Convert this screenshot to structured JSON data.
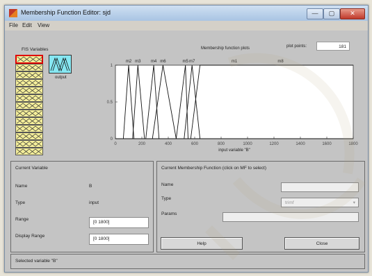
{
  "window": {
    "title": "Membership Function Editor: sjd",
    "minimize_glyph": "—",
    "maximize_glyph": "▢",
    "close_glyph": "✕"
  },
  "menu": [
    "File",
    "Edit",
    "View"
  ],
  "fis": {
    "title": "FIS Variables",
    "output_label": "output",
    "input_count": 13,
    "selected_index": 0
  },
  "plot": {
    "title": "Membership function plots",
    "plot_points_label": "plot points:",
    "plot_points_value": "181",
    "xlabel": "input variable \"B\"",
    "y_ticks": [
      "1",
      "0.5",
      "0"
    ],
    "x_ticks": [
      "0",
      "200",
      "400",
      "600",
      "800",
      "1000",
      "1200",
      "1400",
      "1600",
      "1800"
    ],
    "mf_labels": [
      "m2",
      "m3",
      "m4",
      "m6",
      "m5",
      "m7",
      "m1",
      "m8"
    ]
  },
  "chart_data": {
    "type": "line",
    "xlabel": "input variable \"B\"",
    "xlim": [
      0,
      1800
    ],
    "ylim": [
      0,
      1
    ],
    "series": [
      {
        "name": "m2",
        "x": [
          60,
          100,
          140
        ],
        "y": [
          0,
          1,
          0
        ]
      },
      {
        "name": "m3",
        "x": [
          130,
          170,
          220
        ],
        "y": [
          0,
          1,
          0
        ]
      },
      {
        "name": "m4",
        "x": [
          230,
          290,
          330
        ],
        "y": [
          0,
          1,
          0
        ]
      },
      {
        "name": "m6",
        "x": [
          280,
          360,
          460
        ],
        "y": [
          0,
          1,
          0
        ]
      },
      {
        "name": "m5",
        "x": [
          460,
          530,
          550
        ],
        "y": [
          0,
          1,
          0
        ]
      },
      {
        "name": "m7",
        "x": [
          520,
          580,
          640
        ],
        "y": [
          0,
          1,
          0
        ]
      },
      {
        "name": "m1",
        "x": [
          570,
          640,
          1800
        ],
        "y": [
          0,
          1,
          1
        ]
      },
      {
        "name": "m8",
        "x": [
          0,
          60,
          1800
        ],
        "y": [
          0,
          0,
          0
        ]
      }
    ]
  },
  "current_variable": {
    "title": "Current Variable",
    "name_label": "Name",
    "name_value": "B",
    "type_label": "Type",
    "type_value": "input",
    "range_label": "Range",
    "range_value": "[0 1800]",
    "display_range_label": "Display Range",
    "display_range_value": "[0 1800]"
  },
  "current_mf": {
    "title": "Current Membership Function (click on MF to select)",
    "name_label": "Name",
    "name_value": "",
    "type_label": "Type",
    "type_value": "trimf",
    "params_label": "Params",
    "params_value": ""
  },
  "buttons": {
    "help": "Help",
    "close": "Close"
  },
  "status": "Selected variable \"B\"",
  "colors": {
    "input_block": "#f4ee9a",
    "output_block": "#86e7f2",
    "selection": "#e00000"
  }
}
